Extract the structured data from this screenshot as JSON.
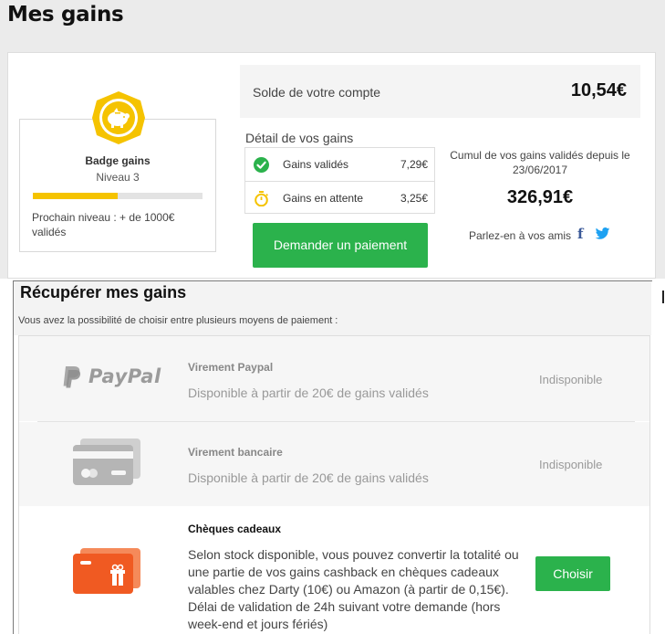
{
  "page": {
    "title": "Mes gains"
  },
  "badge": {
    "title": "Badge gains",
    "level": "Niveau 3",
    "progress_fraction": 0.5,
    "next_level": "Prochain niveau : + de 1000€ validés",
    "icon": "piggy-bank-icon"
  },
  "balance": {
    "label": "Solde de votre compte",
    "value": "10,54€"
  },
  "detail": {
    "title": "Détail de vos gains",
    "rows": [
      {
        "label": "Gains validés",
        "value": "7,29€",
        "icon": "check-circle-icon"
      },
      {
        "label": "Gains en attente",
        "value": "3,25€",
        "icon": "stopwatch-icon"
      }
    ]
  },
  "cumul": {
    "label": "Cumul de vos gains validés depuis le 23/06/2017",
    "value": "326,91€"
  },
  "share": {
    "label": "Parlez-en à vos amis",
    "facebook": "f"
  },
  "payment_button": "Demander un paiement",
  "recup": {
    "title": "Récupérer mes gains",
    "subtitle": "Vous avez la possibilité de choisir entre plusieurs moyens de paiement :",
    "methods": [
      {
        "logo": "PayPal",
        "name": "Virement Paypal",
        "desc": "Disponible à partir de 20€ de gains validés",
        "status": "Indisponible"
      },
      {
        "name": "Virement bancaire",
        "desc": "Disponible à partir de 20€ de gains validés",
        "status": "Indisponible"
      },
      {
        "name": "Chèques cadeaux",
        "desc": "Selon stock disponible, vous pouvez convertir la totalité ou une partie de vos gains cashback en chèques cadeaux valables chez Darty (10€) ou Amazon (à partir de 0,15€). Délai de validation de 24h suivant votre demande (hors week-end et jours fériés)",
        "button": "Choisir"
      }
    ]
  },
  "colors": {
    "green": "#2bb24c",
    "yellow": "#f5c300",
    "orange": "#f05a22",
    "facebook": "#3b5998",
    "twitter": "#1da1f2"
  }
}
